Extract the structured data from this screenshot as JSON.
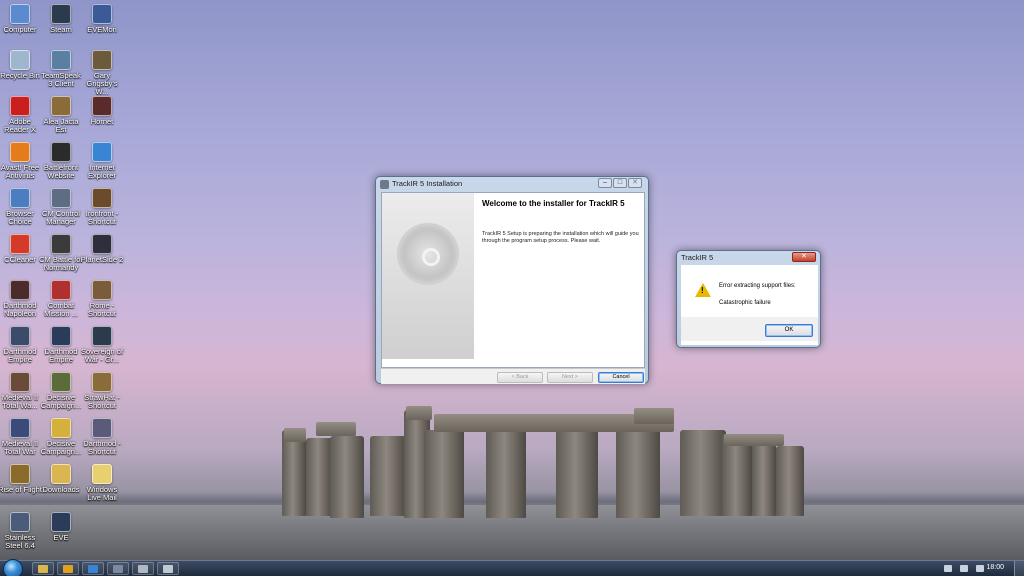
{
  "desktop_icons": [
    {
      "label": "Computer",
      "icon": "computer-icon",
      "color": "#5a8bd0"
    },
    {
      "label": "Steam",
      "icon": "steam-icon",
      "color": "#2b3a4d"
    },
    {
      "label": "EVEMon",
      "icon": "evemon-icon",
      "color": "#3a5b98"
    },
    {
      "label": "Recycle Bin",
      "icon": "recycle-bin-icon",
      "color": "#9fb6cf"
    },
    {
      "label": "TeamSpeak 3 Client",
      "icon": "teamspeak-icon",
      "color": "#5b7fa3"
    },
    {
      "label": "Gary Grigsby's W...",
      "icon": "game-icon",
      "color": "#6b5a3b"
    },
    {
      "label": "Adobe Reader X",
      "icon": "adobe-reader-icon",
      "color": "#c91f1f"
    },
    {
      "label": "Alea Jacta Est",
      "icon": "game-icon",
      "color": "#8a6b3a"
    },
    {
      "label": "Hornet",
      "icon": "hornet-icon",
      "color": "#5a2b2b"
    },
    {
      "label": "Avast! Free Antivirus",
      "icon": "avast-icon",
      "color": "#e47c1c"
    },
    {
      "label": "Battlefront Website",
      "icon": "battlefront-icon",
      "color": "#2b2b2b"
    },
    {
      "label": "Internet Explorer",
      "icon": "internet-explorer-icon",
      "color": "#3a84d6"
    },
    {
      "label": "Browser Choice",
      "icon": "browser-choice-icon",
      "color": "#4b7ec0"
    },
    {
      "label": "CM Control Manager",
      "icon": "control-manager-icon",
      "color": "#5d6d85"
    },
    {
      "label": "Ironfront - Shortcut",
      "icon": "game-icon",
      "color": "#6a4b2b"
    },
    {
      "label": "CCleaner",
      "icon": "ccleaner-icon",
      "color": "#d43a2a"
    },
    {
      "label": "CM Battle for Normandy",
      "icon": "game-icon",
      "color": "#3b3b3b"
    },
    {
      "label": "PlanetSide 2",
      "icon": "planetside-icon",
      "color": "#2e2e3d"
    },
    {
      "label": "Darthmod Napoleon",
      "icon": "game-icon",
      "color": "#4b2b2b"
    },
    {
      "label": "Combat Mission ...",
      "icon": "game-icon",
      "color": "#b03030"
    },
    {
      "label": "Rome - Shortcut",
      "icon": "game-icon",
      "color": "#7a5b3a"
    },
    {
      "label": "Darthmod Empire",
      "icon": "game-icon",
      "color": "#3b4b6a"
    },
    {
      "label": "Darthmod Empire",
      "icon": "game-icon",
      "color": "#2b3b5a"
    },
    {
      "label": "Sovereign of War - Gr...",
      "icon": "game-icon",
      "color": "#2b3b4b"
    },
    {
      "label": "Medieval II Total Wa...",
      "icon": "game-icon",
      "color": "#6a4b3a"
    },
    {
      "label": "Decisive Campaign...",
      "icon": "game-icon",
      "color": "#5b6b3a"
    },
    {
      "label": "StrawHat - Shortcut",
      "icon": "game-icon",
      "color": "#8a6b3a"
    },
    {
      "label": "Medieval II Total War",
      "icon": "game-icon",
      "color": "#3a4b7a"
    },
    {
      "label": "Decisive Campaign...",
      "icon": "game-icon",
      "color": "#d4b13a"
    },
    {
      "label": "Darthmod - Shortcut",
      "icon": "game-icon",
      "color": "#5a5a7a"
    },
    {
      "label": "Rise of Flight",
      "icon": "game-icon",
      "color": "#8a6b2b"
    },
    {
      "label": "Downloads",
      "icon": "downloads-folder-icon",
      "color": "#d9b650"
    },
    {
      "label": "Windows Live Mail",
      "icon": "live-mail-icon",
      "color": "#e8d070"
    },
    {
      "label": "Stainless Steel 6.4",
      "icon": "game-icon",
      "color": "#4b5b7a"
    },
    {
      "label": "EVE",
      "icon": "eve-icon",
      "color": "#2b3b5a"
    }
  ],
  "installer": {
    "title": "TrackIR 5 Installation",
    "heading": "Welcome to the installer for TrackIR 5",
    "body": "TrackIR 5 Setup is preparing the installation which will guide you through the program setup process. Please wait.",
    "back_label": "< Back",
    "next_label": "Next >",
    "cancel_label": "Cancel"
  },
  "error_dialog": {
    "title": "TrackIR 5",
    "message": "Error extracting support files:",
    "detail": "Catastrophic failure",
    "ok_label": "OK"
  },
  "taskbar": {
    "clock": "18:00",
    "items": [
      {
        "icon": "explorer-folder-icon",
        "color": "#d9b650"
      },
      {
        "icon": "media-player-icon",
        "color": "#e0a020"
      },
      {
        "icon": "internet-explorer-icon",
        "color": "#3a84d6"
      },
      {
        "icon": "control-manager-icon",
        "color": "#7a8aa3"
      },
      {
        "icon": "trackir-installer-icon",
        "color": "#b0b8c4"
      },
      {
        "icon": "trackir-dialog-icon",
        "color": "#c0c8d4"
      }
    ]
  },
  "colors": {
    "sky_top": "#8f95c9",
    "sky_mid": "#cdb6da",
    "taskbar": "#1e2a3d",
    "warning": "#e8b700"
  }
}
